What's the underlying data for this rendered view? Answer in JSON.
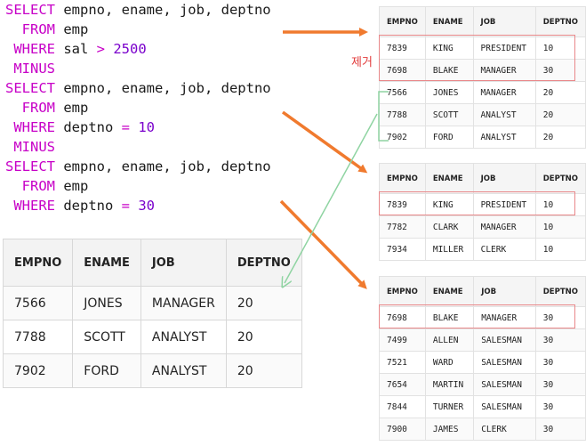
{
  "sql": {
    "lines": [
      {
        "kw": "SELECT",
        "rest": " empno, ename, job, deptno"
      },
      {
        "kw": "  FROM",
        "rest": " emp"
      },
      {
        "kw": " WHERE",
        "rest": " sal ",
        "op": ">",
        "num": " 2500"
      },
      {
        "kw": " MINUS",
        "rest": ""
      },
      {
        "kw": "SELECT",
        "rest": " empno, ename, job, deptno"
      },
      {
        "kw": "  FROM",
        "rest": " emp"
      },
      {
        "kw": " WHERE",
        "rest": " deptno ",
        "op": "=",
        "num": " 10"
      },
      {
        "kw": " MINUS",
        "rest": ""
      },
      {
        "kw": "SELECT",
        "rest": " empno, ename, job, deptno"
      },
      {
        "kw": "  FROM",
        "rest": " emp"
      },
      {
        "kw": " WHERE",
        "rest": " deptno ",
        "op": "=",
        "num": " 30"
      }
    ]
  },
  "remove_label": "제거",
  "headers": [
    "EMPNO",
    "ENAME",
    "JOB",
    "DEPTNO"
  ],
  "table_top": [
    [
      "7839",
      "KING",
      "PRESIDENT",
      "10"
    ],
    [
      "7698",
      "BLAKE",
      "MANAGER",
      "30"
    ],
    [
      "7566",
      "JONES",
      "MANAGER",
      "20"
    ],
    [
      "7788",
      "SCOTT",
      "ANALYST",
      "20"
    ],
    [
      "7902",
      "FORD",
      "ANALYST",
      "20"
    ]
  ],
  "table_mid": [
    [
      "7839",
      "KING",
      "PRESIDENT",
      "10"
    ],
    [
      "7782",
      "CLARK",
      "MANAGER",
      "10"
    ],
    [
      "7934",
      "MILLER",
      "CLERK",
      "10"
    ]
  ],
  "table_bot": [
    [
      "7698",
      "BLAKE",
      "MANAGER",
      "30"
    ],
    [
      "7499",
      "ALLEN",
      "SALESMAN",
      "30"
    ],
    [
      "7521",
      "WARD",
      "SALESMAN",
      "30"
    ],
    [
      "7654",
      "MARTIN",
      "SALESMAN",
      "30"
    ],
    [
      "7844",
      "TURNER",
      "SALESMAN",
      "30"
    ],
    [
      "7900",
      "JAMES",
      "CLERK",
      "30"
    ]
  ],
  "result": [
    [
      "7566",
      "JONES",
      "MANAGER",
      "20"
    ],
    [
      "7788",
      "SCOTT",
      "ANALYST",
      "20"
    ],
    [
      "7902",
      "FORD",
      "ANALYST",
      "20"
    ]
  ],
  "colors": {
    "keyword": "#c700c7",
    "orange_arrow": "#f07a2e",
    "green_arrow": "#8fd4a2",
    "highlight": "#e9888a",
    "remove_text": "#e23b3b"
  }
}
